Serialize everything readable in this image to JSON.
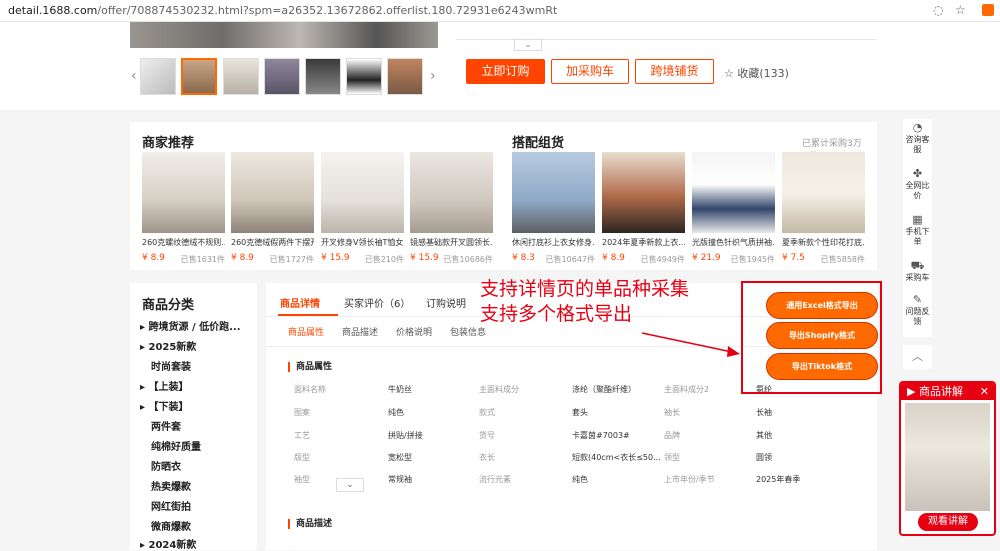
{
  "browser": {
    "url_host": "detail.1688.com",
    "url_path": "/offer/708874530232.html?spm=a26352.13672862.offerlist.180.72931e6243wmRt",
    "icons": [
      "eye-off-icon",
      "star-icon",
      "extension-icon"
    ]
  },
  "top": {
    "buy_now": "立即订购",
    "add_cart": "加采购车",
    "cross_border": "跨境铺货",
    "favorite": "收藏(133)"
  },
  "recommend": {
    "title": "商家推荐",
    "items": [
      {
        "name": "260克螺纹德绒不规则...",
        "price": "¥ 8.9",
        "sold": "已售1631件"
      },
      {
        "name": "260克德绒假两件下摆开...",
        "price": "¥ 8.9",
        "sold": "已售1727件"
      },
      {
        "name": "开叉修身V领长袖T恤女...",
        "price": "¥ 15.9",
        "sold": "已售210件"
      },
      {
        "name": "镜感基础款开叉圆领长...",
        "price": "¥ 15.9",
        "sold": "已售10686件"
      }
    ]
  },
  "combo": {
    "title": "搭配组货",
    "note": "已累计采购3万+件",
    "items": [
      {
        "name": "休闲打底衫上衣女修身...",
        "price": "¥ 8.3",
        "sold": "已售10647件"
      },
      {
        "name": "2024年夏季新款上衣...",
        "price": "¥ 8.9",
        "sold": "已售4949件"
      },
      {
        "name": "光版撞色针织气质拼袖...",
        "price": "¥ 21.9",
        "sold": "已售1945件"
      },
      {
        "name": "夏季新款个性印花打底...",
        "price": "¥ 7.5",
        "sold": "已售5858件"
      }
    ]
  },
  "categories": {
    "title": "商品分类",
    "items": [
      {
        "label": "▸ 跨境货源 / 低价跑...",
        "arrow": true
      },
      {
        "label": "▸ 2025新款",
        "arrow": true
      },
      {
        "label": "时尚套装",
        "arrow": false
      },
      {
        "label": "▸ 【上装】",
        "arrow": true
      },
      {
        "label": "▸ 【下装】",
        "arrow": true
      },
      {
        "label": "两件套",
        "arrow": false
      },
      {
        "label": "纯棉好质量",
        "arrow": false
      },
      {
        "label": "防晒衣",
        "arrow": false
      },
      {
        "label": "热卖爆款",
        "arrow": false
      },
      {
        "label": "网红街拍",
        "arrow": false
      },
      {
        "label": "微商爆款",
        "arrow": false
      },
      {
        "label": "▸ 2024新款",
        "arrow": true
      }
    ]
  },
  "detail": {
    "tabs": [
      "商品详情",
      "买家评价（6）",
      "订购说明"
    ],
    "subtabs": [
      "商品属性",
      "商品描述",
      "价格说明",
      "包装信息"
    ],
    "attr_title": "商品属性",
    "desc_title": "商品描述",
    "props": [
      [
        "面料名称",
        "牛奶丝",
        "主面料成分",
        "涤纶（聚酯纤维）",
        "主面料成分2",
        "氨纶"
      ],
      [
        "图案",
        "纯色",
        "款式",
        "套头",
        "袖长",
        "长袖"
      ],
      [
        "工艺",
        "拼贴/拼接",
        "货号",
        "卡嘉茵#7003#",
        "品牌",
        "其他"
      ],
      [
        "版型",
        "宽松型",
        "衣长",
        "短款(40cm<衣长≤50...",
        "领型",
        "圆领"
      ],
      [
        "袖型",
        "常规袖",
        "流行元素",
        "纯色",
        "上市年份/季节",
        "2025年春季"
      ]
    ]
  },
  "annotation": {
    "line1": "支持详情页的单品种采集",
    "line2": "支持多个格式导出"
  },
  "export": {
    "excel": "通用Excel格式导出",
    "shopify": "导出Shopify格式",
    "tiktok": "导出Tiktok格式"
  },
  "rightbar": {
    "items": [
      "咨询客服",
      "全网比价",
      "手机下单",
      "采购车",
      "问题反馈"
    ]
  },
  "live": {
    "title": "商品讲解",
    "button": "观看讲解"
  }
}
